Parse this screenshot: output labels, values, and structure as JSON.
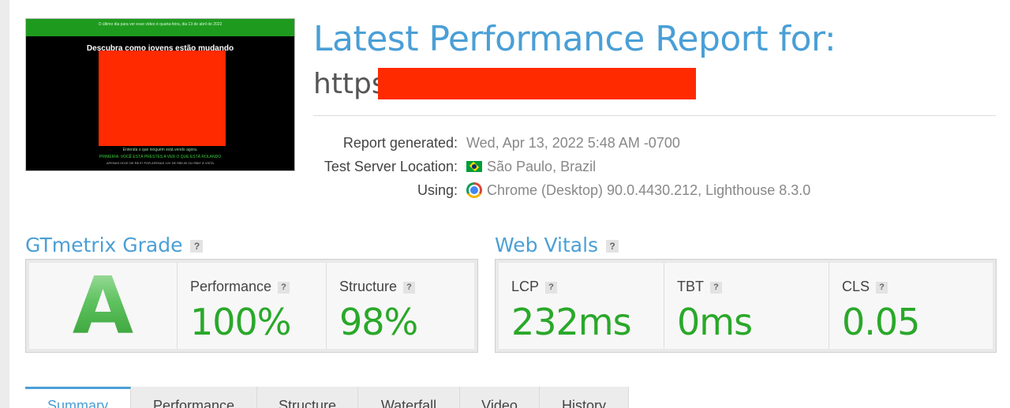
{
  "thumbnail": {
    "banner_text": "O último dia para ver esse vídeo é quarta-feira, dia 13 de abril de 2022",
    "headline": "Descubra como jovens estão mudando",
    "line1": "Entenda o que ninguém está vendo agora.",
    "line2": "PRIMEIRA: VOCÊ ESTÁ PRESTES A VER O QUE ESTÁ ROLANDO",
    "line3": "APENAS HOJE DE R$ 97 POR APENAS 12X DE R$9,90 OU R$97 À VISTA"
  },
  "header": {
    "title": "Latest Performance Report for:",
    "url_prefix": "https"
  },
  "report": {
    "generated_label": "Report generated:",
    "generated_value": "Wed, Apr 13, 2022 5:48 AM -0700",
    "location_label": "Test Server Location:",
    "location_value": "São Paulo, Brazil",
    "using_label": "Using:",
    "using_value": "Chrome (Desktop) 90.0.4430.212, Lighthouse 8.3.0"
  },
  "grade": {
    "title": "GTmetrix Grade",
    "letter": "A",
    "performance_label": "Performance",
    "performance_value": "100%",
    "structure_label": "Structure",
    "structure_value": "98%"
  },
  "vitals": {
    "title": "Web Vitals",
    "lcp_label": "LCP",
    "lcp_value": "232ms",
    "tbt_label": "TBT",
    "tbt_value": "0ms",
    "cls_label": "CLS",
    "cls_value": "0.05"
  },
  "help_glyph": "?",
  "tabs": [
    {
      "label": "Summary"
    },
    {
      "label": "Performance"
    },
    {
      "label": "Structure"
    },
    {
      "label": "Waterfall"
    },
    {
      "label": "Video"
    },
    {
      "label": "History"
    }
  ],
  "colors": {
    "accent": "#4a9fd6",
    "good": "#2aa82a",
    "redaction": "#ff2a00"
  }
}
